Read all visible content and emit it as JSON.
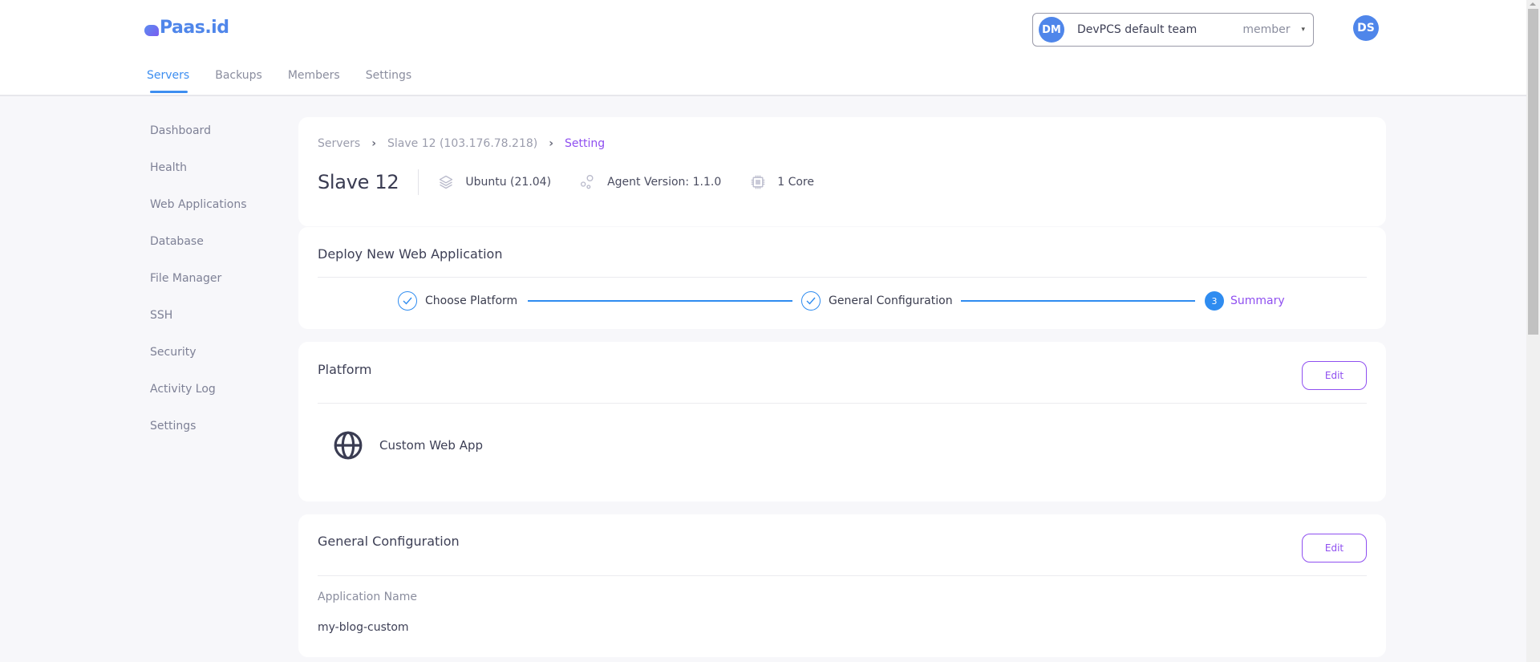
{
  "brand": {
    "name": "Paas.id"
  },
  "topnav": {
    "tabs": [
      {
        "label": "Servers",
        "active": true
      },
      {
        "label": "Backups",
        "active": false
      },
      {
        "label": "Members",
        "active": false
      },
      {
        "label": "Settings",
        "active": false
      }
    ]
  },
  "team": {
    "initials": "DM",
    "name": "DevPCS default team",
    "role": "member",
    "caret_icon": "chevron-down-icon"
  },
  "user": {
    "initials": "DS"
  },
  "sidebar": {
    "items": [
      {
        "label": "Dashboard"
      },
      {
        "label": "Health"
      },
      {
        "label": "Web Applications"
      },
      {
        "label": "Database"
      },
      {
        "label": "File Manager"
      },
      {
        "label": "SSH"
      },
      {
        "label": "Security"
      },
      {
        "label": "Activity Log"
      },
      {
        "label": "Settings"
      }
    ]
  },
  "breadcrumb": {
    "items": [
      "Servers",
      "Slave 12 (103.176.78.218)",
      "Setting"
    ],
    "separator": ">"
  },
  "server": {
    "title": "Slave 12",
    "os": {
      "icon": "layers-icon",
      "label": "Ubuntu (21.04)"
    },
    "agent": {
      "icon": "agent-nodes-icon",
      "label": "Agent Version: 1.1.0"
    },
    "cpu": {
      "icon": "cpu-chip-icon",
      "label": "1 Core"
    }
  },
  "deploy": {
    "title": "Deploy New Web Application",
    "steps": [
      {
        "label": "Choose Platform",
        "status": "done"
      },
      {
        "label": "General Configuration",
        "status": "done"
      },
      {
        "label": "Summary",
        "status": "active",
        "number": "3"
      }
    ]
  },
  "platform": {
    "title": "Platform",
    "edit_label": "Edit",
    "selected": {
      "icon": "globe-icon",
      "name": "Custom Web App"
    }
  },
  "general": {
    "title": "General Configuration",
    "edit_label": "Edit",
    "fields": [
      {
        "label": "Application Name",
        "value": "my-blog-custom"
      }
    ]
  },
  "colors": {
    "primary_blue": "#2f8cf0",
    "accent_purple": "#8f4ff0",
    "brand_blue": "#4f86ea"
  }
}
